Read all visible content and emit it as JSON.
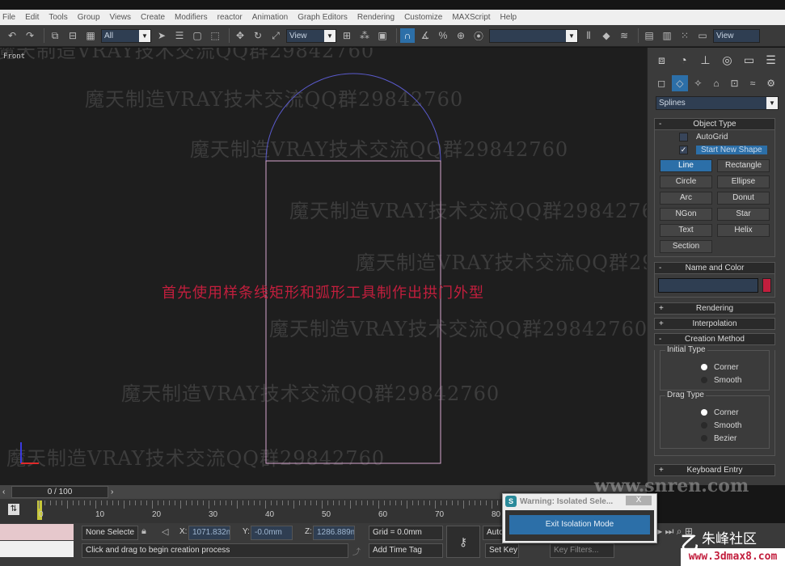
{
  "menu": [
    "File",
    "Edit",
    "Tools",
    "Group",
    "Views",
    "Create",
    "Modifiers",
    "reactor",
    "Animation",
    "Graph Editors",
    "Rendering",
    "Customize",
    "MAXScript",
    "Help"
  ],
  "toolbar": {
    "selection_filter": "All",
    "ref_coord": "View",
    "named_selection": "",
    "viewport_dropdown": "View"
  },
  "viewport": {
    "label": "Front",
    "caption": "首先使用样条线矩形和弧形工具制作出拱门外型",
    "watermark_text": "魔天制造VRAY技术交流QQ群29842760",
    "shape_colors": {
      "arc": "#5a5acc",
      "rectangle": "#d6a6cf"
    }
  },
  "command_panel": {
    "category": "Splines",
    "object_type": {
      "title": "Object Type",
      "autogrid": "AutoGrid",
      "start_new_shape": "Start New Shape",
      "buttons": [
        "Line",
        "Rectangle",
        "Circle",
        "Ellipse",
        "Arc",
        "Donut",
        "NGon",
        "Star",
        "Text",
        "Helix",
        "Section"
      ],
      "active": "Line"
    },
    "name_and_color": {
      "title": "Name and Color",
      "name_value": "",
      "color": "#c21e3d"
    },
    "rendering": "Rendering",
    "interpolation": "Interpolation",
    "creation_method": {
      "title": "Creation Method",
      "initial_type": {
        "label": "Initial Type",
        "options": [
          "Corner",
          "Smooth"
        ],
        "selected": "Corner"
      },
      "drag_type": {
        "label": "Drag Type",
        "options": [
          "Corner",
          "Smooth",
          "Bezier"
        ],
        "selected": "Corner"
      }
    },
    "keyboard_entry": "Keyboard Entry"
  },
  "timeline": {
    "slider_text": "0 / 100",
    "ticks": [
      "0",
      "10",
      "20",
      "30",
      "40",
      "50",
      "60",
      "70",
      "80"
    ]
  },
  "status": {
    "selection": "None Selecte",
    "x_label": "X:",
    "x_value": "1071.832m",
    "y_label": "Y:",
    "y_value": "-0.0mm",
    "z_label": "Z:",
    "z_value": "1286.889m",
    "grid": "Grid = 0.0mm",
    "prompt": "Click and drag to begin creation process",
    "add_time_tag": "Add Time Tag",
    "auto_key": "Auto",
    "set_key": "Set Key",
    "key_filters": "Key Filters..."
  },
  "dialog": {
    "title": "Warning: Isolated Sele...",
    "close": "X",
    "button": "Exit Isolation Mode"
  },
  "site_watermark": "www.snren.com",
  "logo": {
    "name": "朱峰社区",
    "url": "www.3dmax8.com"
  }
}
